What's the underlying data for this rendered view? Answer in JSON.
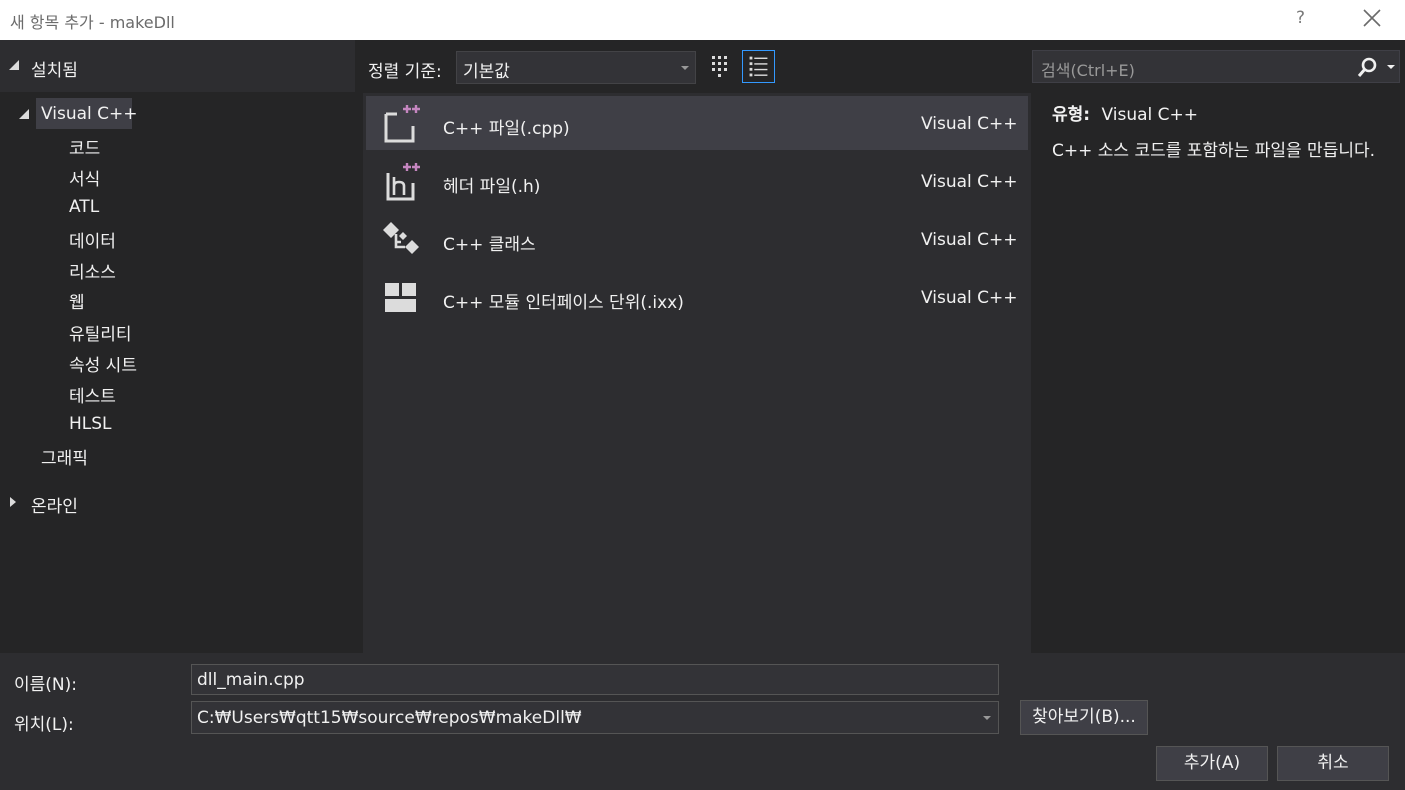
{
  "window": {
    "title": "새 항목 추가 - makeDll",
    "help_label": "?"
  },
  "sidebar": {
    "header": "설치됨",
    "root": "Visual C++",
    "children": [
      "코드",
      "서식",
      "ATL",
      "데이터",
      "리소스",
      "웹",
      "유틸리티",
      "속성 시트",
      "테스트",
      "HLSL"
    ],
    "graphics": "그래픽",
    "online": "온라인"
  },
  "sort": {
    "label": "정렬 기준:",
    "value": "기본값"
  },
  "search": {
    "placeholder": "검색(Ctrl+E)"
  },
  "items": [
    {
      "name": "C++ 파일(.cpp)",
      "lang": "Visual C++",
      "icon": "cpp-file-icon",
      "selected": true
    },
    {
      "name": "헤더 파일(.h)",
      "lang": "Visual C++",
      "icon": "header-file-icon",
      "selected": false
    },
    {
      "name": "C++ 클래스",
      "lang": "Visual C++",
      "icon": "class-icon",
      "selected": false
    },
    {
      "name": "C++ 모듈 인터페이스 단위(.ixx)",
      "lang": "Visual C++",
      "icon": "module-icon",
      "selected": false
    }
  ],
  "detail": {
    "type_label": "유형:",
    "type_value": "Visual C++",
    "description": "C++ 소스 코드를 포함하는 파일을 만듭니다."
  },
  "form": {
    "name_label": "이름(N):",
    "name_value": "dll_main.cpp",
    "location_label": "위치(L):",
    "location_value": "C:₩Users₩qtt15₩source₩repos₩makeDll₩",
    "browse_label": "찾아보기(B)...",
    "add_label": "추가(A)",
    "cancel_label": "취소"
  },
  "colors": {
    "accent": "#3399ff",
    "plus_badge": "#c586c0",
    "background": "#252526"
  }
}
